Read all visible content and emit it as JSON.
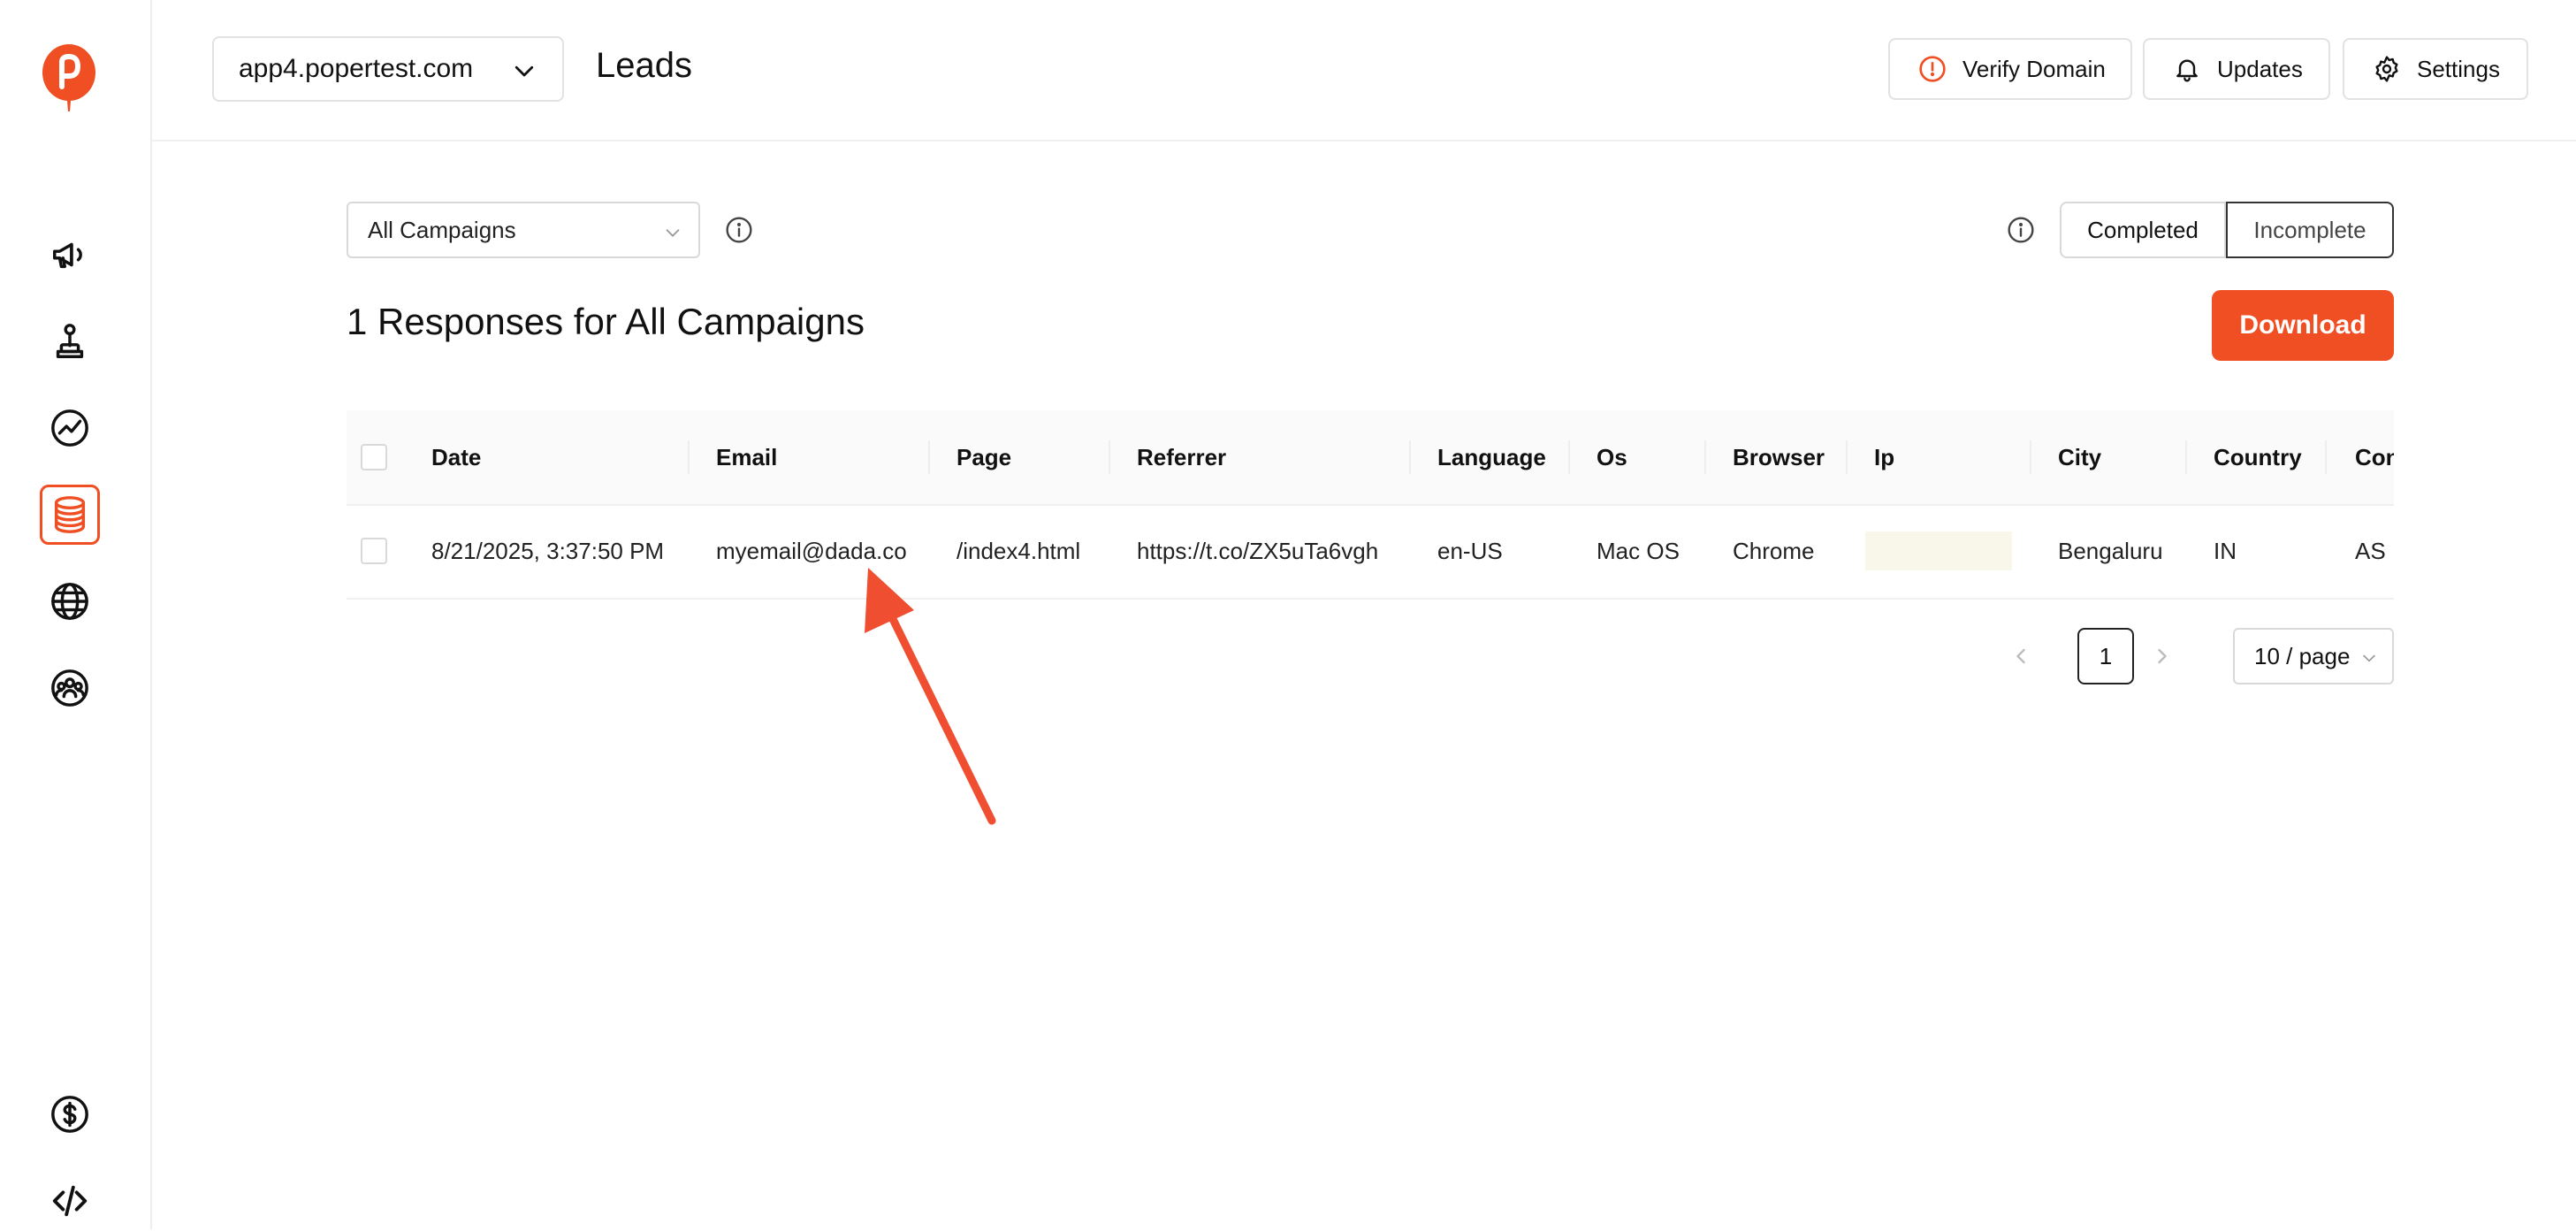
{
  "header": {
    "domain": "app4.popertest.com",
    "title": "Leads",
    "verify_domain": "Verify Domain",
    "updates": "Updates",
    "settings": "Settings"
  },
  "sidebar": {
    "items": [
      {
        "icon": "megaphone-icon"
      },
      {
        "icon": "joystick-icon"
      },
      {
        "icon": "trending-chart-icon"
      },
      {
        "icon": "database-icon",
        "active": true
      },
      {
        "icon": "globe-icon"
      },
      {
        "icon": "users-group-icon"
      },
      {
        "icon": "dollar-icon"
      },
      {
        "icon": "code-icon"
      }
    ]
  },
  "filters": {
    "campaign": "All Campaigns",
    "completed": "Completed",
    "incomplete": "Incomplete"
  },
  "summary": {
    "title": "1 Responses for All Campaigns",
    "download": "Download"
  },
  "table": {
    "headers": [
      "Date",
      "Email",
      "Page",
      "Referrer",
      "Language",
      "Os",
      "Browser",
      "Ip",
      "City",
      "Country",
      "Con"
    ],
    "rows": [
      [
        "8/21/2025, 3:37:50 PM",
        "myemail@dada.co",
        "/index4.html",
        "https://t.co/ZX5uTa6vgh",
        "en-US",
        "Mac OS",
        "Chrome",
        "",
        "Bengaluru",
        "IN",
        "AS"
      ]
    ]
  },
  "pagination": {
    "current": "1",
    "page_size": "10 / page"
  },
  "colors": {
    "accent": "#f04e23",
    "annotation_arrow": "#f04e30",
    "ip_highlight": "#f9f6ea"
  }
}
